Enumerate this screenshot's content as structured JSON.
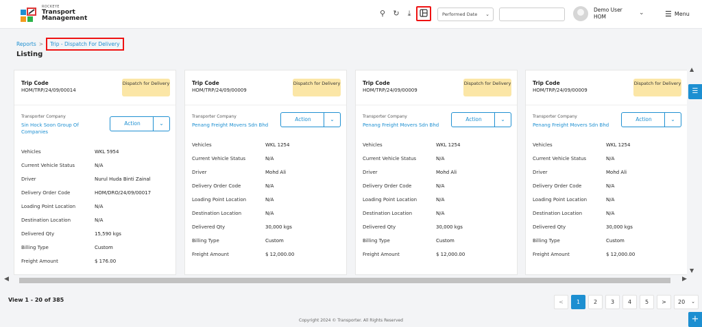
{
  "header": {
    "brand_small": "ROCKEYE",
    "brand_line1": "Transport",
    "brand_line2": "Management",
    "date_filter": "Performed Date",
    "user_name": "Demo User",
    "user_branch": "HOM",
    "menu_label": "Menu",
    "icons": [
      "search-icon",
      "refresh-icon",
      "download-icon",
      "column-layout-icon"
    ]
  },
  "breadcrumb": {
    "root": "Reports",
    "separator": ">",
    "current": "Trip - Dispatch For Delivery"
  },
  "page_title": "Listing",
  "card_labels": {
    "trip_code": "Trip Code",
    "transporter_company": "Transporter Company",
    "action": "Action"
  },
  "cards": [
    {
      "trip_code": "HOM/TRP/24/09/00014",
      "status": "Dispatch for Delivery",
      "transporter": "Sin Hock Soon Group Of Companies",
      "fields": [
        {
          "k": "Vehicles",
          "v": "WKL 5954"
        },
        {
          "k": "Current Vehicle Status",
          "v": "N/A"
        },
        {
          "k": "Driver",
          "v": "Nurul Huda Binti Zainal"
        },
        {
          "k": "Delivery Order Code",
          "v": "HOM/DRO/24/09/00017"
        },
        {
          "k": "Loading Point Location",
          "v": "N/A"
        },
        {
          "k": "Destination Location",
          "v": "N/A"
        },
        {
          "k": "Delivered Qty",
          "v": "15,590 kgs"
        },
        {
          "k": "Billing Type",
          "v": "Custom"
        },
        {
          "k": "Freight Amount",
          "v": "$ 176.00"
        }
      ]
    },
    {
      "trip_code": "HOM/TRP/24/09/00009",
      "status": "Dispatch for Delivery",
      "transporter": "Penang Freight Movers Sdn Bhd",
      "fields": [
        {
          "k": "Vehicles",
          "v": "WKL 1254"
        },
        {
          "k": "Current Vehicle Status",
          "v": "N/A"
        },
        {
          "k": "Driver",
          "v": "Mohd Ali"
        },
        {
          "k": "Delivery Order Code",
          "v": "N/A"
        },
        {
          "k": "Loading Point Location",
          "v": "N/A"
        },
        {
          "k": "Destination Location",
          "v": "N/A"
        },
        {
          "k": "Delivered Qty",
          "v": "30,000 kgs"
        },
        {
          "k": "Billing Type",
          "v": "Custom"
        },
        {
          "k": "Freight Amount",
          "v": "$ 12,000.00"
        }
      ]
    },
    {
      "trip_code": "HOM/TRP/24/09/00009",
      "status": "Dispatch for Delivery",
      "transporter": "Penang Freight Movers Sdn Bhd",
      "fields": [
        {
          "k": "Vehicles",
          "v": "WKL 1254"
        },
        {
          "k": "Current Vehicle Status",
          "v": "N/A"
        },
        {
          "k": "Driver",
          "v": "Mohd Ali"
        },
        {
          "k": "Delivery Order Code",
          "v": "N/A"
        },
        {
          "k": "Loading Point Location",
          "v": "N/A"
        },
        {
          "k": "Destination Location",
          "v": "N/A"
        },
        {
          "k": "Delivered Qty",
          "v": "30,000 kgs"
        },
        {
          "k": "Billing Type",
          "v": "Custom"
        },
        {
          "k": "Freight Amount",
          "v": "$ 12,000.00"
        }
      ]
    },
    {
      "trip_code": "HOM/TRP/24/09/00009",
      "status": "Dispatch for Delivery",
      "transporter": "Penang Freight Movers Sdn Bhd",
      "fields": [
        {
          "k": "Vehicles",
          "v": "WKL 1254"
        },
        {
          "k": "Current Vehicle Status",
          "v": "N/A"
        },
        {
          "k": "Driver",
          "v": "Mohd Ali"
        },
        {
          "k": "Delivery Order Code",
          "v": "N/A"
        },
        {
          "k": "Loading Point Location",
          "v": "N/A"
        },
        {
          "k": "Destination Location",
          "v": "N/A"
        },
        {
          "k": "Delivered Qty",
          "v": "30,000 kgs"
        },
        {
          "k": "Billing Type",
          "v": "Custom"
        },
        {
          "k": "Freight Amount",
          "v": "$ 12,000.00"
        }
      ]
    }
  ],
  "footer": {
    "view_count": "View 1 - 20 of 385",
    "pages": [
      "1",
      "2",
      "3",
      "4",
      "5"
    ],
    "active_page": "1",
    "prev": "<",
    "next": ">",
    "page_size": "20",
    "copyright": "Copyright 2024 © Transporter. All Rights Reserved"
  },
  "colors": {
    "accent": "#1d8fd1",
    "badge": "#fbe6a6",
    "highlight": "#ee1111"
  }
}
